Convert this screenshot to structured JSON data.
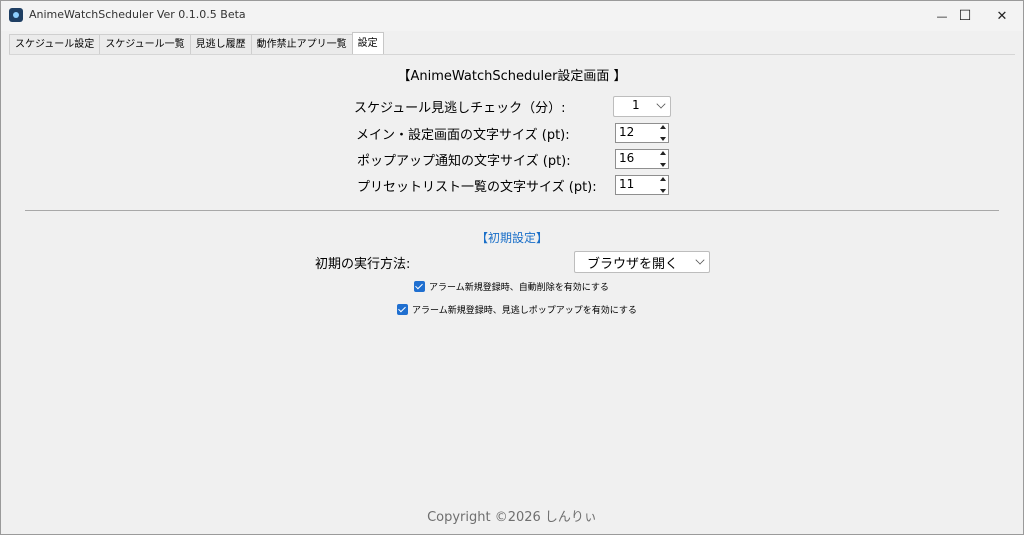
{
  "window": {
    "title": "AnimeWatchScheduler Ver 0.1.0.5 Beta",
    "minimize_glyph": "—",
    "maximize_glyph": "☐",
    "close_glyph": "✕"
  },
  "tabs": [
    {
      "label": "スケジュール設定",
      "active": false
    },
    {
      "label": "スケジュール一覧",
      "active": false
    },
    {
      "label": "見逃し履歴",
      "active": false
    },
    {
      "label": "動作禁止アプリ一覧",
      "active": false
    },
    {
      "label": "設定",
      "active": true
    }
  ],
  "settings": {
    "title": "【AnimeWatchScheduler設定画面 】",
    "check_interval": {
      "label": "スケジュール見逃しチェック（分）:",
      "value": "1"
    },
    "main_font_size": {
      "label": "メイン・設定画面の文字サイズ (pt):",
      "value": "12"
    },
    "popup_font_size": {
      "label": "ポップアップ通知の文字サイズ (pt):",
      "value": "16"
    },
    "preset_font_size": {
      "label": "プリセットリスト一覧の文字サイズ (pt):",
      "value": "11"
    }
  },
  "initial": {
    "title": "【初期設定】",
    "method_label": "初期の実行方法:",
    "method_value": "ブラウザを開く",
    "check_auto_delete": {
      "label": "アラーム新規登録時、自動削除を有効にする",
      "checked": true
    },
    "check_missed_popup": {
      "label": "アラーム新規登録時、見逃しポップアップを有効にする",
      "checked": true
    }
  },
  "footer": {
    "copyright": "Copyright ©2026 しんりぃ"
  },
  "colors": {
    "accent": "#1f6fd0",
    "section_title": "#1a6fc8",
    "footer_text": "#6f6f6f"
  }
}
